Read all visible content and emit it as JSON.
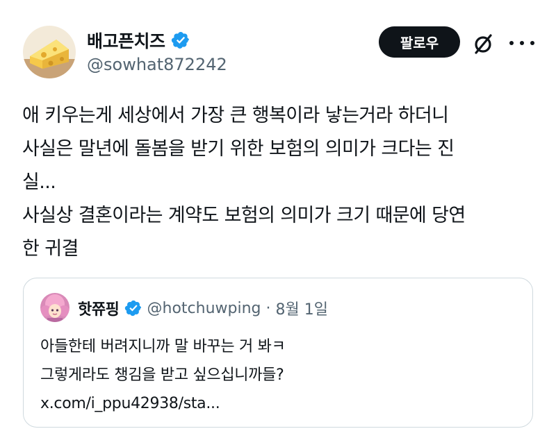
{
  "author": {
    "display_name": "배고픈치즈",
    "handle": "@sowhat872242",
    "avatar_icon": "cheese-avatar",
    "verified_icon": "verified-badge-icon"
  },
  "actions": {
    "follow_label": "팔로우",
    "grok_icon": "grok-slash-icon",
    "more_icon": "more-options-icon"
  },
  "tweet": {
    "lines": [
      "애 키우는게 세상에서 가장 큰 행복이라 낳는거라 하더니",
      "사실은 말년에 돌봄을 받기 위한 보험의 의미가 크다는 진",
      "실...",
      "사실상 결혼이라는 계약도 보험의 의미가 크기 때문에 당연",
      "한 귀결"
    ]
  },
  "quoted": {
    "display_name": "핫쮸핑",
    "handle": "@hotchuwping",
    "separator": "·",
    "date": "8월 1일",
    "lines": [
      "아들한테 버려지니까 말 바꾸는 거 봐ㅋ",
      "그렇게라도 챙김을 받고 싶으십니까들?",
      "x.com/i_ppu42938/sta..."
    ]
  },
  "colors": {
    "text": "#0f1419",
    "secondary": "#536471",
    "verified": "#1d9bf0",
    "border": "#cfd9de"
  }
}
